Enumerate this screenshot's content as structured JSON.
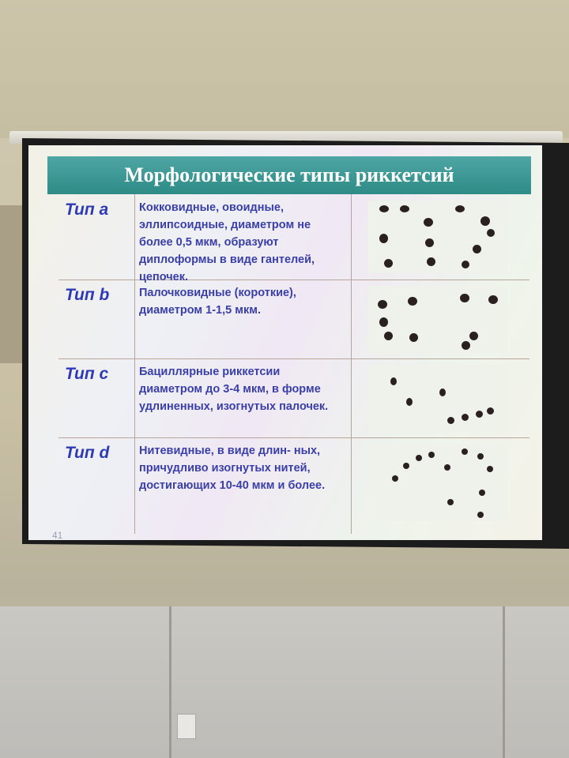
{
  "slide": {
    "title": "Морфологические типы риккетсий",
    "slide_number": "41",
    "rows": [
      {
        "label": "Тип a",
        "description": "Кокковидные, овоидные, эллипсоидные, диаметром не более 0,5 мкм, образуют диплоформы в виде гантелей, цепочек."
      },
      {
        "label": "Тип b",
        "description": "Палочковидные (короткие), диаметром  1-1,5 мкм."
      },
      {
        "label": "Тип c",
        "description": "Бациллярные риккетсии диаметром до 3-4 мкм, в форме удлиненных, изогнутых палочек."
      },
      {
        "label": "Тип d",
        "description": "Нитевидные, в виде длин- ных, причудливо изогнутых нитей,  достигающих 10-40 мкм и более."
      }
    ]
  },
  "colors": {
    "title_bar": "#2e8b86",
    "title_text": "#ffffff",
    "row_text": "#3a3fa8",
    "grid": "#b7a59a"
  }
}
